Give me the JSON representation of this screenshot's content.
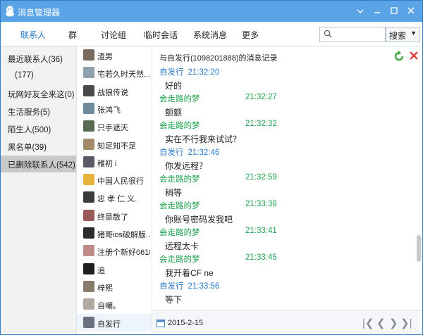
{
  "window": {
    "title": "消息管理器"
  },
  "tabs": [
    "联系人",
    "群",
    "讨论组",
    "临时会话",
    "系统消息",
    "更多"
  ],
  "search": {
    "placeholder": "",
    "button_label": "搜索"
  },
  "left_nav": [
    {
      "label": "最近联系人(36)"
    },
    {
      "label": "(177)"
    },
    {
      "label": "玩网好友全来这(0)"
    },
    {
      "label": "生活服务(5)"
    },
    {
      "label": "陌生人(500)"
    },
    {
      "label": "黑名单(39)"
    },
    {
      "label": "已删除联系人(542)"
    }
  ],
  "contacts": [
    {
      "name": "渣男",
      "color": "#7a6a5e"
    },
    {
      "name": "宅若久时天然...",
      "color": "#8fa2b0"
    },
    {
      "name": "战狼传说",
      "color": "#4a4a4a"
    },
    {
      "name": "张鸿飞",
      "color": "#6e8a9c"
    },
    {
      "name": "只手遮天",
      "color": "#586a52"
    },
    {
      "name": "知足知不足",
      "color": "#a38b6a"
    },
    {
      "name": "稚初 i",
      "color": "#5a5a66"
    },
    {
      "name": "中国人民很行",
      "color": "#e8b33a"
    },
    {
      "name": "忠 孝 仁 义.",
      "color": "#3b3b3b"
    },
    {
      "name": "终是散了",
      "color": "#9a5a5a"
    },
    {
      "name": "猪哥ios破解版...",
      "color": "#2b2b2b"
    },
    {
      "name": "注册个新好0618",
      "color": "#c08a8a"
    },
    {
      "name": "追",
      "color": "#1e1e1e"
    },
    {
      "name": "梓熙",
      "color": "#8a7a6a"
    },
    {
      "name": "自嘲。",
      "color": "#b0a9a0"
    },
    {
      "name": "自发行",
      "color": "#6a7280"
    }
  ],
  "message_header": "与自发行(1098201888)的消息记录",
  "messages": [
    {
      "kind": "me",
      "sender": "自发行",
      "time": "21:32:20"
    },
    {
      "kind": "text",
      "text": "好的"
    },
    {
      "kind": "them",
      "sender": "会走路的梦",
      "time": "21:32:27"
    },
    {
      "kind": "text",
      "text": "额额"
    },
    {
      "kind": "them",
      "sender": "会走路的梦",
      "time": "21:32:32"
    },
    {
      "kind": "text",
      "text": "实在不行我来试试？"
    },
    {
      "kind": "me",
      "sender": "自发行",
      "time": "21:32:46"
    },
    {
      "kind": "text",
      "text": "你发远程？"
    },
    {
      "kind": "them",
      "sender": "会走路的梦",
      "time": "21:32:59"
    },
    {
      "kind": "text",
      "text": "稍等"
    },
    {
      "kind": "them",
      "sender": "会走路的梦",
      "time": "21:33:38"
    },
    {
      "kind": "text",
      "text": "你账号密码发我吧"
    },
    {
      "kind": "them",
      "sender": "会走路的梦",
      "time": "21:33:41"
    },
    {
      "kind": "text",
      "text": "远程太卡"
    },
    {
      "kind": "them",
      "sender": "会走路的梦",
      "time": "21:33:45"
    },
    {
      "kind": "text",
      "text": "我开着CF ne"
    },
    {
      "kind": "me",
      "sender": "自发行",
      "time": "21:33:56"
    },
    {
      "kind": "text",
      "text": "等下"
    }
  ],
  "footer": {
    "date": "2015-2-15"
  },
  "colors": {
    "title_bar": "#5aa3e6",
    "tab_active": "#2a78c9",
    "sender_them": "#1fa14d",
    "sender_me": "#2a78c9"
  }
}
